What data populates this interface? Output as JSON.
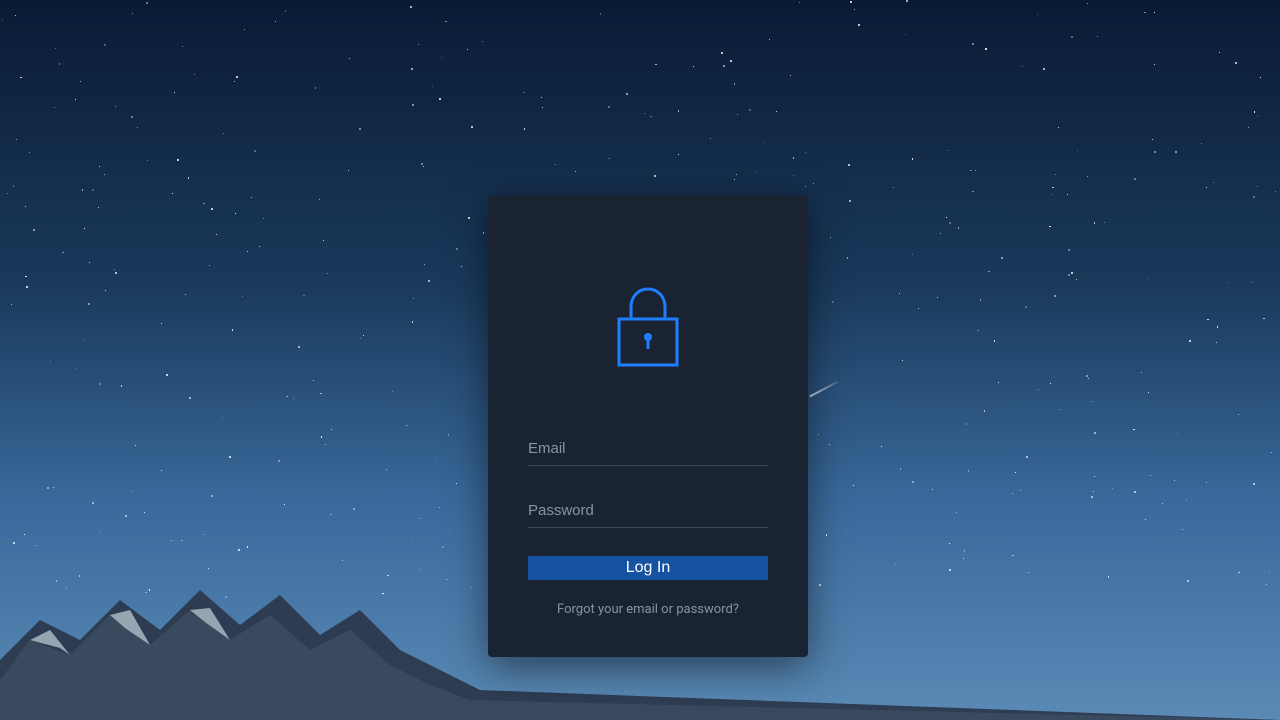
{
  "login": {
    "email_placeholder": "Email",
    "password_placeholder": "Password",
    "button_label": "Log In",
    "forgot_link": "Forgot your email or password?"
  },
  "colors": {
    "accent": "#1d7eff",
    "button_bg": "#1553a0",
    "card_bg": "#1a2332"
  }
}
